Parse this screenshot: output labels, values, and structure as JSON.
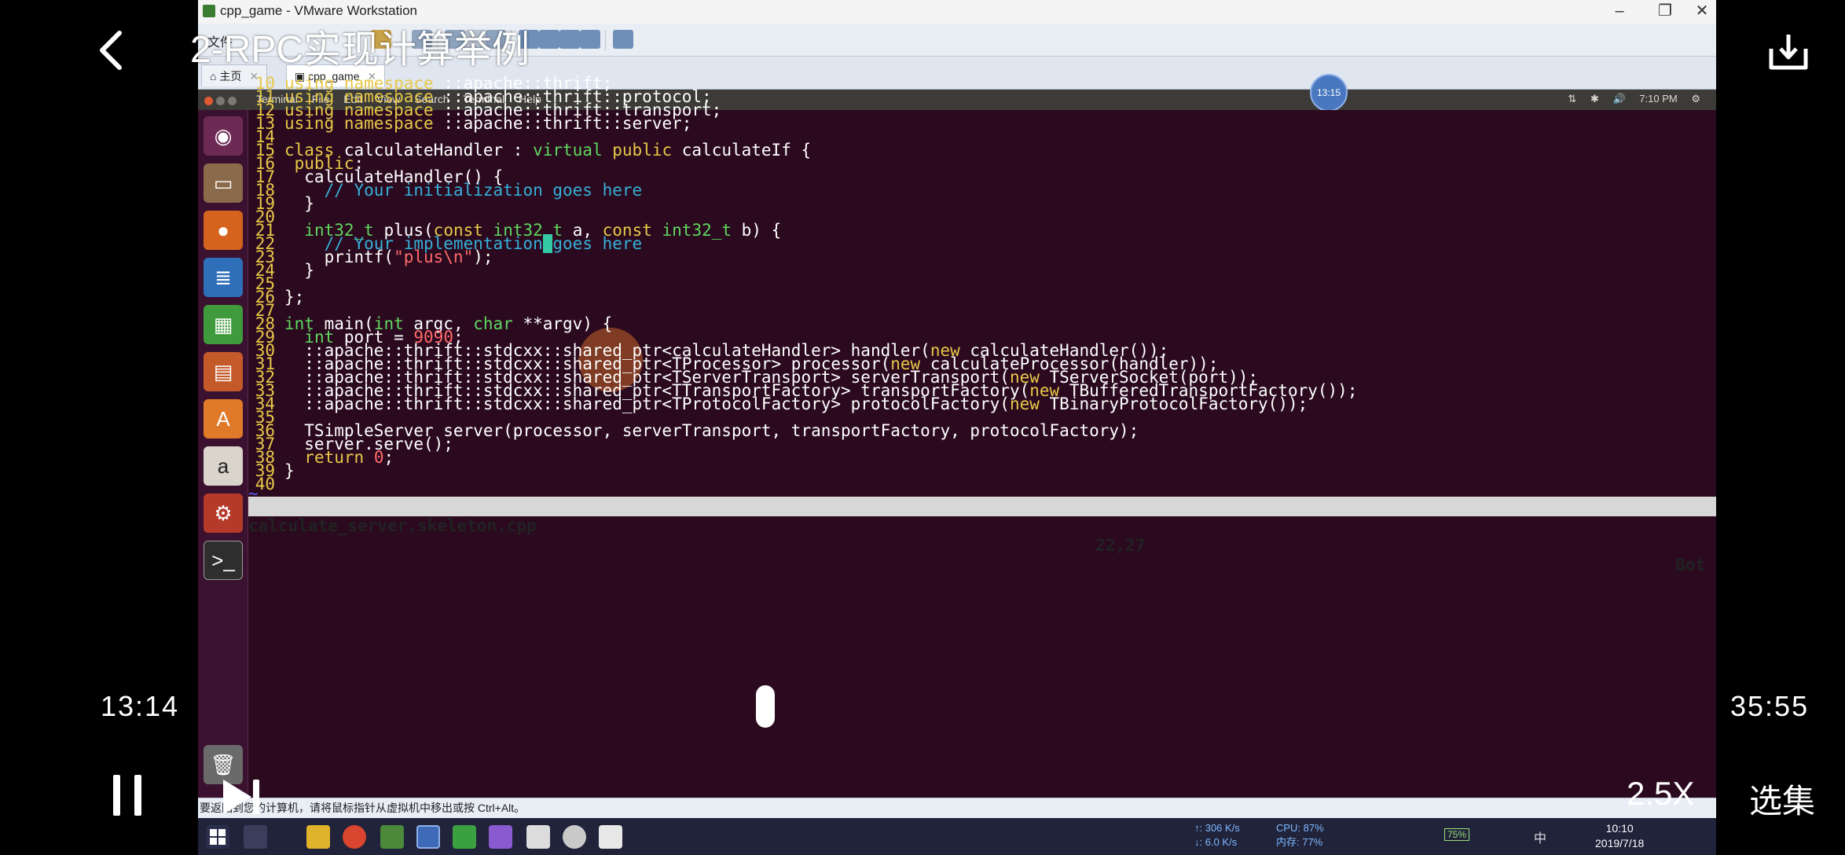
{
  "player": {
    "back_icon": "chevron-left-icon",
    "title": "2-RPC实现计算举例",
    "download_icon": "download-icon",
    "time_current": "13:14",
    "time_total": "35:55",
    "progress_fraction": 0.368,
    "pause_icon": "pause-icon",
    "next_icon": "next-icon",
    "speed_label": "2.5X",
    "episodes_label": "选集"
  },
  "vmware": {
    "window_title": "cpp_game - VMware Workstation",
    "menu_file": "文件",
    "tabs": [
      {
        "label": "主页",
        "active": false
      },
      {
        "label": "cpp_game",
        "active": true
      }
    ],
    "status_bar_text": "要返回到您的计算机，请将鼠标指针从虚拟机中移出或按 Ctrl+Alt。"
  },
  "ubuntu": {
    "menus": [
      "Terminal",
      "File",
      "Edit",
      "View",
      "Search",
      "Terminal",
      "Help"
    ],
    "clock": "7:10 PM",
    "overlay_clock": "13:15",
    "launcher_icons": [
      "ubuntu-logo-icon",
      "files-icon",
      "firefox-icon",
      "writer-icon",
      "calc-icon",
      "impress-icon",
      "software-center-icon",
      "amazon-icon",
      "settings-icon",
      "terminal-icon"
    ]
  },
  "editor": {
    "lines": [
      {
        "n": "10",
        "text": "using namespace ::apache::thrift;"
      },
      {
        "n": "11",
        "text": "using namespace ::apache::thrift::protocol;"
      },
      {
        "n": "12",
        "text": "using namespace ::apache::thrift::transport;"
      },
      {
        "n": "13",
        "text": "using namespace ::apache::thrift::server;"
      },
      {
        "n": "14",
        "text": ""
      },
      {
        "n": "15",
        "text": "class calculateHandler : virtual public calculateIf {"
      },
      {
        "n": "16",
        "text": " public:"
      },
      {
        "n": "17",
        "text": "  calculateHandler() {"
      },
      {
        "n": "18",
        "text": "    // Your initialization goes here"
      },
      {
        "n": "19",
        "text": "  }"
      },
      {
        "n": "20",
        "text": ""
      },
      {
        "n": "21",
        "text": "  int32_t plus(const int32_t a, const int32_t b) {"
      },
      {
        "n": "22",
        "text": "    // Your implementation goes here"
      },
      {
        "n": "23",
        "text": "    printf(\"plus\\n\");"
      },
      {
        "n": "24",
        "text": "  }"
      },
      {
        "n": "25",
        "text": ""
      },
      {
        "n": "26",
        "text": "};"
      },
      {
        "n": "27",
        "text": ""
      },
      {
        "n": "28",
        "text": "int main(int argc, char **argv) {"
      },
      {
        "n": "29",
        "text": "  int port = 9090;"
      },
      {
        "n": "30",
        "text": "  ::apache::thrift::stdcxx::shared_ptr<calculateHandler> handler(new calculateHandler());"
      },
      {
        "n": "31",
        "text": "  ::apache::thrift::stdcxx::shared_ptr<TProcessor> processor(new calculateProcessor(handler));"
      },
      {
        "n": "32",
        "text": "  ::apache::thrift::stdcxx::shared_ptr<TServerTransport> serverTransport(new TServerSocket(port));"
      },
      {
        "n": "33",
        "text": "  ::apache::thrift::stdcxx::shared_ptr<TTransportFactory> transportFactory(new TBufferedTransportFactory());"
      },
      {
        "n": "34",
        "text": "  ::apache::thrift::stdcxx::shared_ptr<TProtocolFactory> protocolFactory(new TBinaryProtocolFactory());"
      },
      {
        "n": "35",
        "text": ""
      },
      {
        "n": "36",
        "text": "  TSimpleServer server(processor, serverTransport, transportFactory, protocolFactory);"
      },
      {
        "n": "37",
        "text": "  server.serve();"
      },
      {
        "n": "38",
        "text": "  return 0;"
      },
      {
        "n": "39",
        "text": "}"
      },
      {
        "n": "40",
        "text": ""
      }
    ],
    "tilde": "~",
    "status_file": "calculate_server.skeleton.cpp",
    "status_pos": "22,27",
    "status_scroll": "Bot",
    "cursor_line": "22",
    "cursor_col": "27"
  },
  "taskbar": {
    "net_up": "↑: 306 K/s",
    "net_down": "↓: 6.0 K/s",
    "cpu": "CPU:  87%",
    "mem": "内存:  77%",
    "battery": "75%",
    "ime": "中",
    "time": "10:10",
    "date": "2019/7/18"
  },
  "colors": {
    "terminal_bg": "#2b0a1f",
    "keyword": "#e8c848",
    "type": "#5fd75f",
    "comment": "#36b0d8",
    "literal": "#ff6a6a"
  }
}
